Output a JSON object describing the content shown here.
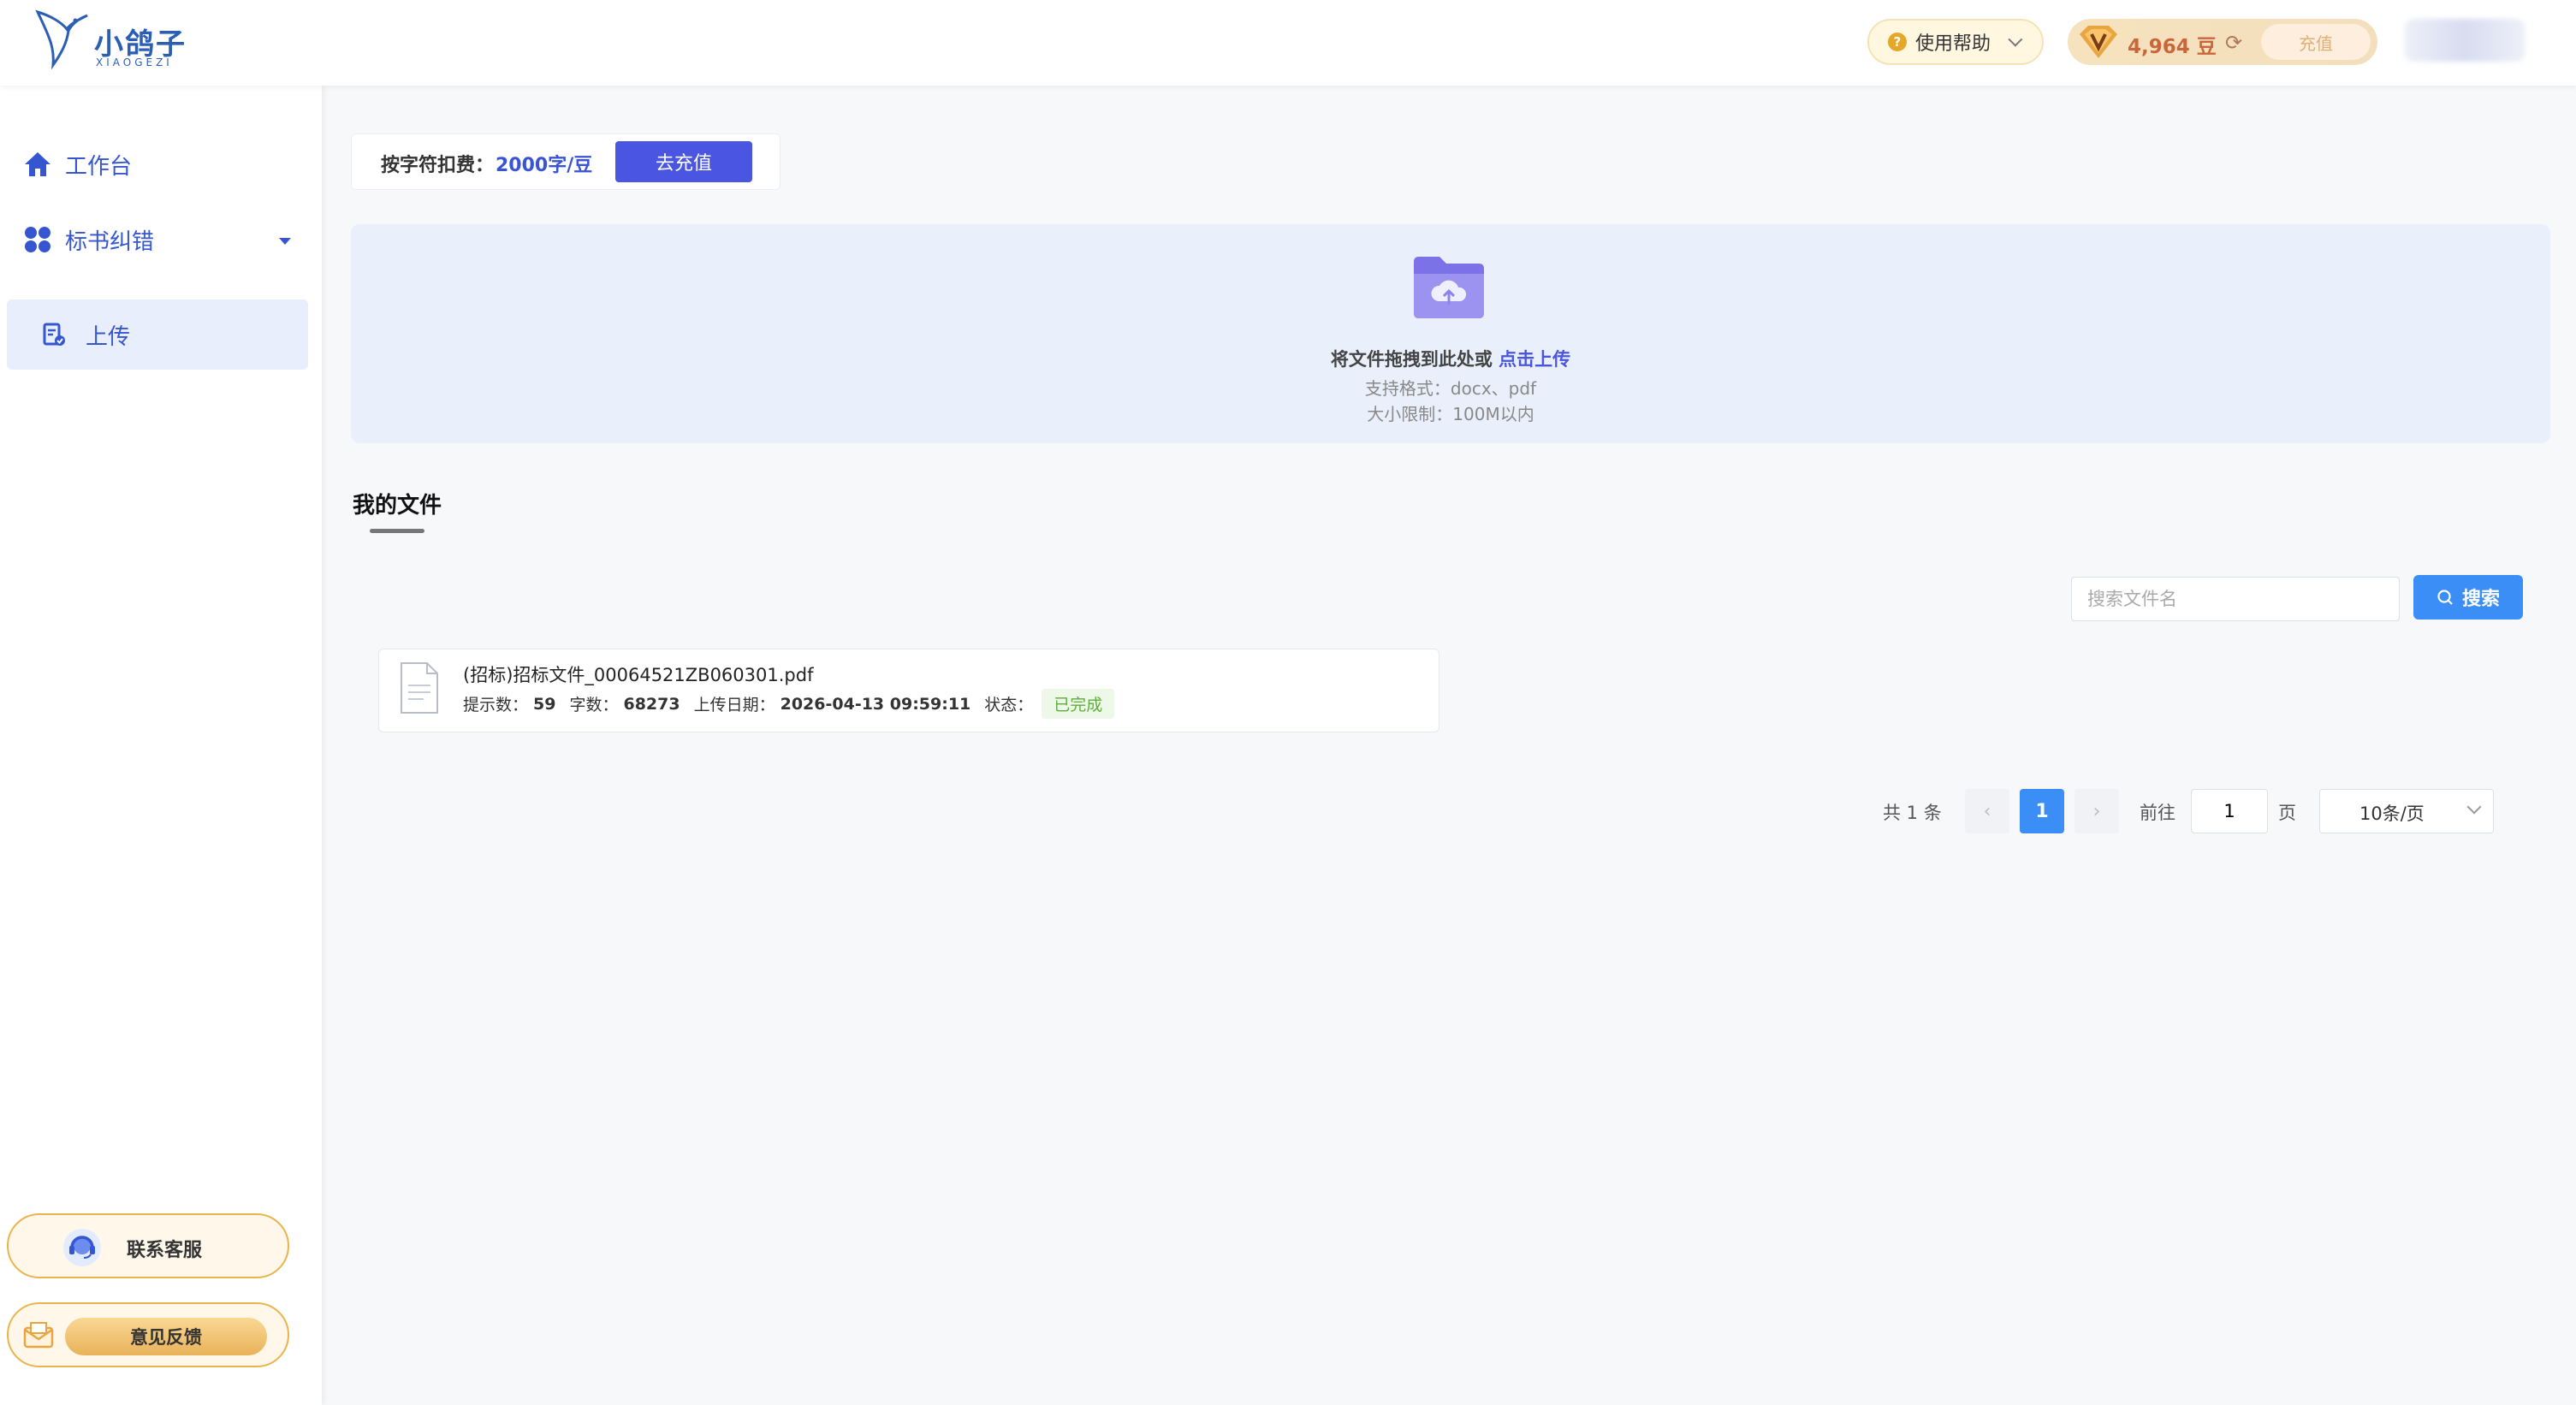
{
  "brand": {
    "name": "小鸽子",
    "sub": "XIAOGEZI"
  },
  "header": {
    "help_label": "使用帮助",
    "bean_count": "4,964 豆",
    "recharge_label": "充值"
  },
  "sidebar": {
    "items": [
      {
        "label": "工作台",
        "icon": "home-icon"
      },
      {
        "label": "标书纠错",
        "icon": "grid-icon"
      },
      {
        "label": "上传",
        "icon": "upload-doc-icon"
      }
    ],
    "support_label": "联系客服",
    "feedback_label": "意见反馈"
  },
  "pricing": {
    "label": "按字符扣费：",
    "value": "2000字/豆",
    "button": "去充值"
  },
  "upload": {
    "prompt": "将文件拖拽到此处或",
    "link": "点击上传",
    "formats": "支持格式：docx、pdf",
    "size_limit": "大小限制：100M以内"
  },
  "files": {
    "section_title": "我的文件",
    "search_placeholder": "搜索文件名",
    "search_button": "搜索",
    "list": [
      {
        "name": "(招标)招标文件_00064521ZB060301.pdf",
        "hints_label": "提示数：",
        "hints": "59",
        "words_label": "字数：",
        "words": "68273",
        "date_label": "上传日期：",
        "date": "2026-04-13 09:59:11",
        "status_label": "状态：",
        "status": "已完成"
      }
    ]
  },
  "pagination": {
    "total": "共 1 条",
    "prev": "‹",
    "current": "1",
    "next": "›",
    "goto_label": "前往",
    "goto_value": "1",
    "page_unit": "页",
    "page_size": "10条/页"
  },
  "colors": {
    "primary": "#4a56e2",
    "accent_blue": "#3a8ef6",
    "status_green": "#5fae3b",
    "gold": "#e9b44c"
  }
}
